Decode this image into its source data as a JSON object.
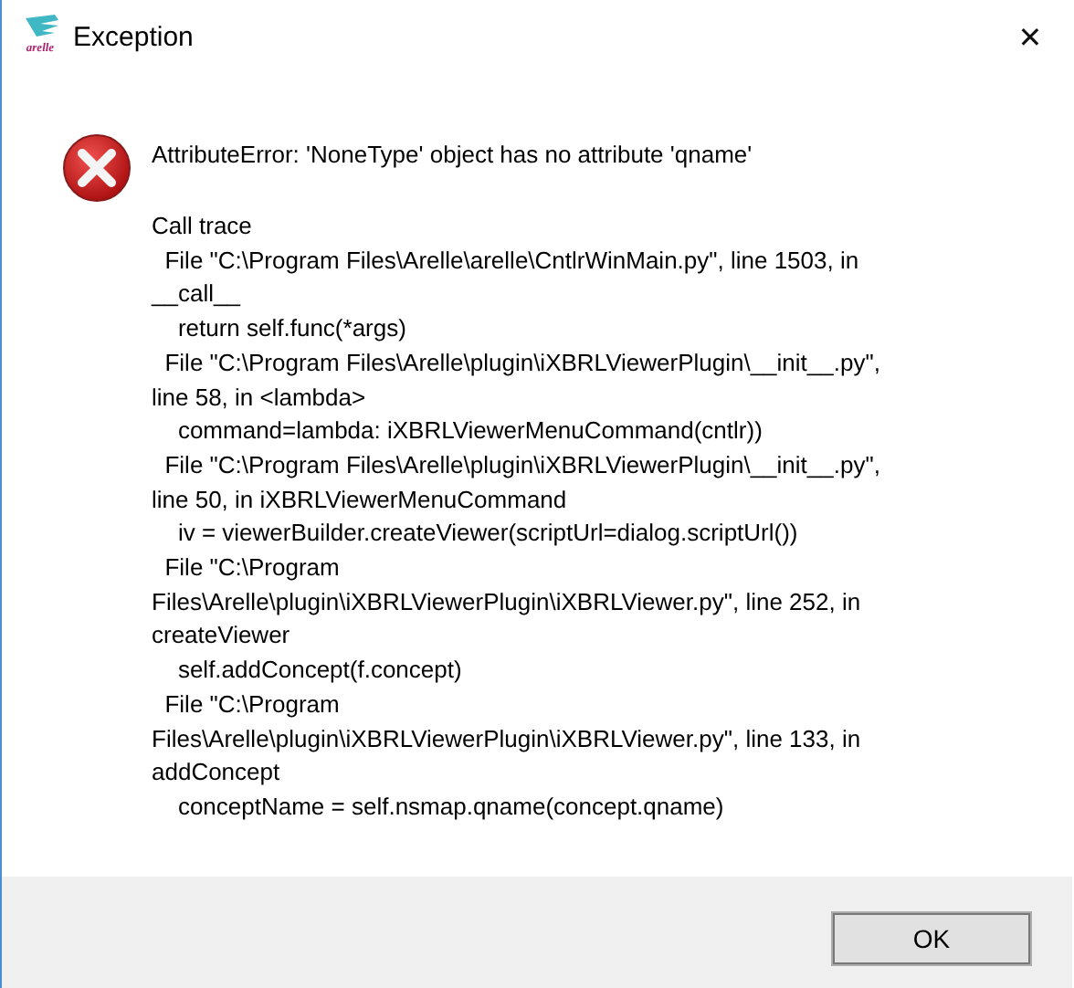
{
  "window": {
    "title": "Exception",
    "logo_text": "arelle",
    "close": "✕"
  },
  "message": "AttributeError: 'NoneType' object has no attribute 'qname'",
  "trace_lines": [
    "Call trace",
    "  File \"C:\\Program Files\\Arelle\\arelle\\CntlrWinMain.py\", line 1503, in",
    "__call__",
    "    return self.func(*args)",
    "  File \"C:\\Program Files\\Arelle\\plugin\\iXBRLViewerPlugin\\__init__.py\",",
    "line 58, in <lambda>",
    "    command=lambda: iXBRLViewerMenuCommand(cntlr))",
    "  File \"C:\\Program Files\\Arelle\\plugin\\iXBRLViewerPlugin\\__init__.py\",",
    "line 50, in iXBRLViewerMenuCommand",
    "    iv = viewerBuilder.createViewer(scriptUrl=dialog.scriptUrl())",
    "  File \"C:\\Program",
    "Files\\Arelle\\plugin\\iXBRLViewerPlugin\\iXBRLViewer.py\", line 252, in",
    "createViewer",
    "    self.addConcept(f.concept)",
    "  File \"C:\\Program",
    "Files\\Arelle\\plugin\\iXBRLViewerPlugin\\iXBRLViewer.py\", line 133, in",
    "addConcept",
    "    conceptName = self.nsmap.qname(concept.qname)"
  ],
  "buttons": [
    {
      "label": "OK"
    }
  ]
}
